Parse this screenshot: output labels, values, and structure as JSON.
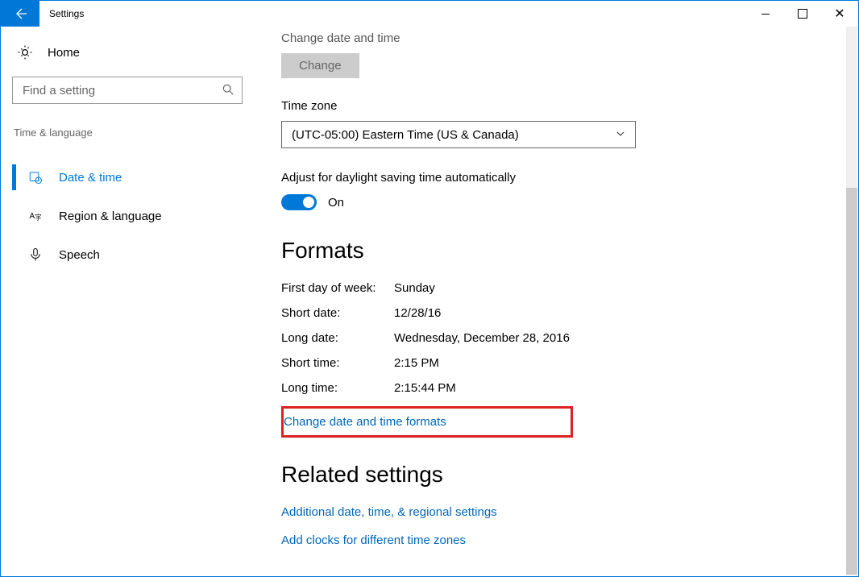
{
  "titlebar": {
    "title": "Settings"
  },
  "sidebar": {
    "home": "Home",
    "search_placeholder": "Find a setting",
    "section": "Time & language",
    "items": [
      {
        "label": "Date & time"
      },
      {
        "label": "Region & language"
      },
      {
        "label": "Speech"
      }
    ]
  },
  "content": {
    "cut_header": "Change date and time",
    "change_button": "Change",
    "timezone_label": "Time zone",
    "timezone_value": "(UTC-05:00) Eastern Time (US & Canada)",
    "dst_label": "Adjust for daylight saving time automatically",
    "dst_state": "On",
    "formats_header": "Formats",
    "rows": [
      {
        "k": "First day of week:",
        "v": "Sunday"
      },
      {
        "k": "Short date:",
        "v": "12/28/16"
      },
      {
        "k": "Long date:",
        "v": "Wednesday, December 28, 2016"
      },
      {
        "k": "Short time:",
        "v": "2:15 PM"
      },
      {
        "k": "Long time:",
        "v": "2:15:44 PM"
      }
    ],
    "change_formats_link": "Change date and time formats",
    "related_header": "Related settings",
    "related_links": [
      "Additional date, time, & regional settings",
      "Add clocks for different time zones"
    ]
  }
}
